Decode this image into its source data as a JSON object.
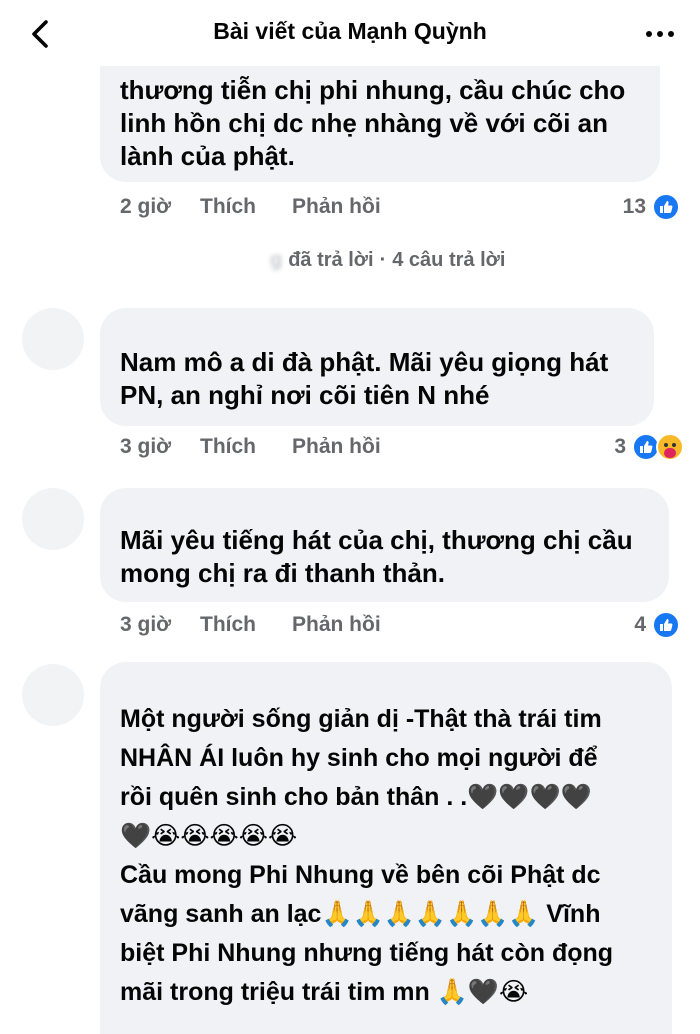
{
  "header": {
    "title": "Bài viết của Mạnh Quỳnh",
    "back_icon": "chevron-left-icon",
    "more_icon": "more-horizontal-icon"
  },
  "comments": [
    {
      "text": "thương tiễn chị phi nhung, cầu chúc cho\nlinh hồn chị dc nhẹ nhàng về với cõi an\nlành của phật.",
      "time": "2 giờ",
      "like_label": "Thích",
      "reply_label": "Phản hồi",
      "reaction_count": "13"
    },
    {
      "text": "Nam mô a di đà phật. Mãi yêu giọng hát\nPN, an nghỉ nơi cõi tiên N nhé",
      "time": "3 giờ",
      "like_label": "Thích",
      "reply_label": "Phản hồi",
      "reaction_count": "3"
    },
    {
      "text": "Mãi yêu tiếng hát của chị, thương chị cầu\nmong chị ra đi thanh thản.",
      "time": "3 giờ",
      "like_label": "Thích",
      "reply_label": "Phản hồi",
      "reaction_count": "4"
    },
    {
      "text": "Một người sống giản dị -Thật thà trái tim\nNHÂN ÁI  luôn hy sinh cho mọi người để\nrồi quên sinh cho bản thân . .🖤🖤🖤🖤\n🖤😭😭😭😭😭\nCầu mong Phi Nhung về bên cõi Phật dc\nvãng sanh an lạc🙏🙏🙏🙏🙏🙏🙏 Vĩnh\nbiệt Phi Nhung nhưng tiếng hát còn đọng\nmãi trong triệu trái tim mn 🙏🖤😭"
    }
  ],
  "replies_summary": {
    "action": "đã trả lời",
    "separator": "·",
    "count": "4 câu trả lời"
  }
}
